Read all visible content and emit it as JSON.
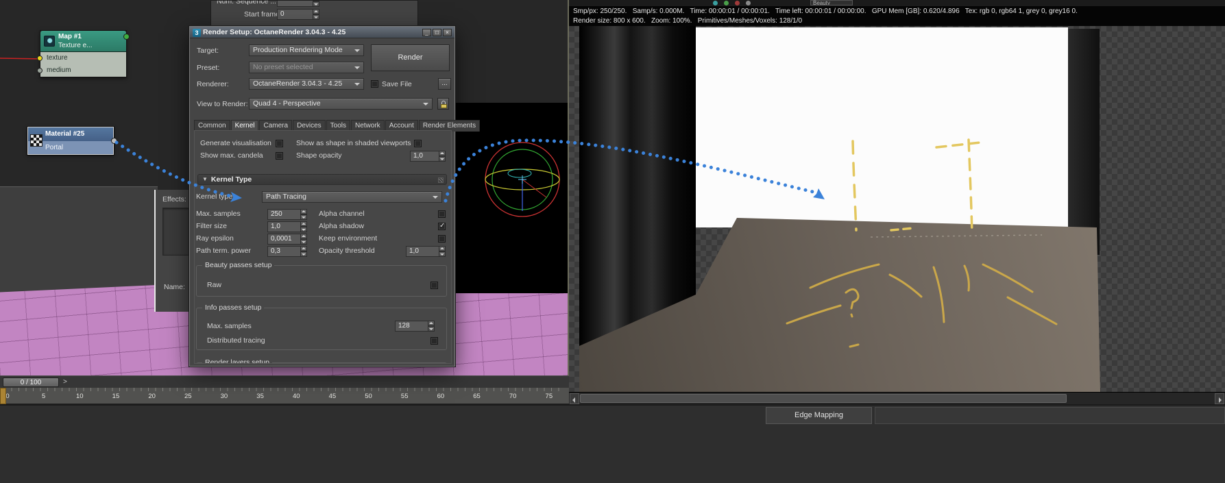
{
  "sequence_panel": {
    "cut_row_label": "Num. Sequence ...",
    "start_frame_label": "Start frame",
    "start_frame_value": "0"
  },
  "node_editor": {
    "map_node": {
      "title": "Map #1",
      "subtitle": "Texture e...",
      "slot1": "texture",
      "slot2": "medium"
    },
    "material_node": {
      "title": "Material #25",
      "subtitle": "Portal"
    }
  },
  "environment_panel": {
    "effects_label": "Effects:",
    "name_label": "Name:"
  },
  "render_dialog": {
    "icon_glyph": "3",
    "title": "Render Setup: OctaneRender 3.04.3 - 4.25",
    "window_buttons": {
      "minimize": "_",
      "maximize": "□",
      "close": "×"
    },
    "rows": {
      "target_label": "Target:",
      "target_value": "Production Rendering Mode",
      "preset_label": "Preset:",
      "preset_value": "No preset selected",
      "renderer_label": "Renderer:",
      "renderer_value": "OctaneRender 3.04.3 - 4.25",
      "save_file_label": "Save File",
      "more_button_label": "...",
      "view_label": "View to Render:",
      "view_value": "Quad 4 - Perspective"
    },
    "render_button_label": "Render",
    "tabs": [
      "Common",
      "Kernel",
      "Camera",
      "Devices",
      "Tools",
      "Network",
      "Account",
      "Render Elements"
    ],
    "active_tab": "Kernel",
    "viz": {
      "generate_visualisation": "Generate visualisation",
      "show_as_shape": "Show as shape in shaded viewports",
      "show_max_candela": "Show max. candela",
      "shape_opacity_label": "Shape opacity",
      "shape_opacity_value": "1,0"
    },
    "kernel": {
      "section_title": "Kernel Type",
      "kernel_type_label": "Kernel type",
      "kernel_type_value": "Path Tracing",
      "params_left": [
        {
          "label": "Max. samples",
          "value": "250"
        },
        {
          "label": "Filter size",
          "value": "1,0"
        },
        {
          "label": "Ray epsilon",
          "value": "0,0001"
        },
        {
          "label": "Path term. power",
          "value": "0,3"
        }
      ],
      "alpha_channel_label": "Alpha channel",
      "alpha_shadow_label": "Alpha shadow",
      "alpha_shadow_checked": true,
      "keep_environment_label": "Keep environment",
      "opacity_threshold_label": "Opacity threshold",
      "opacity_threshold_value": "1,0",
      "beauty_group_title": "Beauty passes setup",
      "raw_label": "Raw",
      "info_group_title": "Info passes setup",
      "info_max_samples_label": "Max. samples",
      "info_max_samples_value": "128",
      "distributed_label": "Distributed tracing",
      "cut_group_title": "Render layers setup"
    }
  },
  "octane_viewport": {
    "toolbar_dropdown": "Beauty",
    "stats_line1": "Smp/px: 250/250.   Samp/s: 0.000M.   Time: 00:00:01 / 00:00:01.   Time left: 00:00:01 / 00:00:00.   GPU Mem [GB]: 0.620/4.896   Tex: rgb 0, rgb64 1, grey 0, grey16 0.",
    "stats_line2": "Render size: 800 x 600.   Zoom: 100%.   Primitives/Meshes/Voxels: 128/1/0"
  },
  "timeline": {
    "position_label": "0 / 100",
    "next_glyph": ">",
    "ticks": [
      "0",
      "5",
      "10",
      "15",
      "20",
      "25",
      "30",
      "35",
      "40",
      "45",
      "50",
      "55",
      "60",
      "65",
      "70",
      "75"
    ]
  },
  "bottom_bar": {
    "edge_mapping_label": "Edge Mapping"
  },
  "colors": {
    "arrow_blue": "#3b82d9",
    "node_map_header": "#2f8f77",
    "node_material_header": "#4a6ca0",
    "viewport_ground": "#c285c2",
    "render_floor": "#6c635a",
    "sketch_yellow": "#cfab49"
  }
}
